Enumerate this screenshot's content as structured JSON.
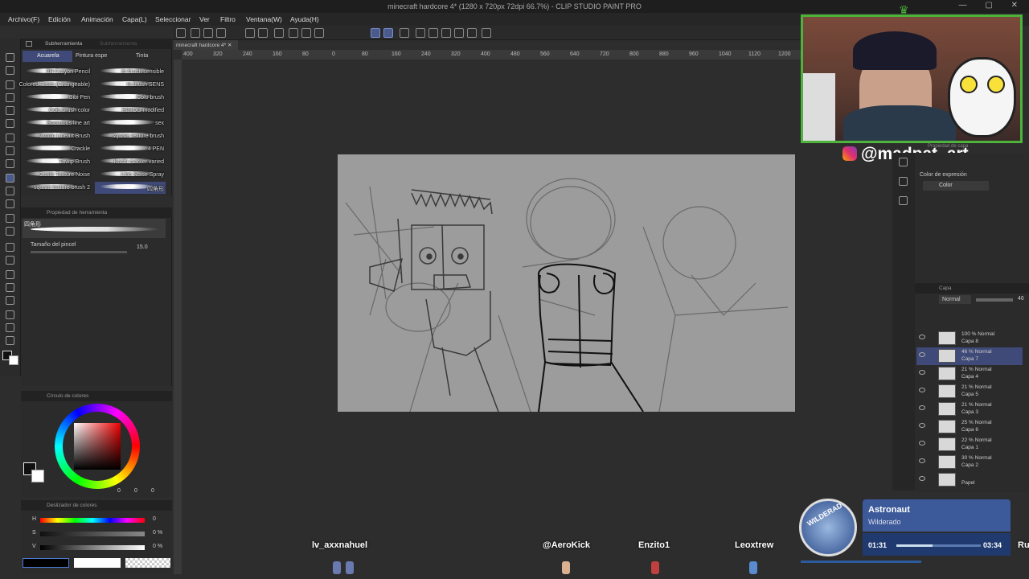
{
  "window": {
    "title": "minecraft hardcore 4* (1280 x 720px 72dpi 66.7%) - CLIP STUDIO PAINT PRO",
    "controls": "— ▢ ✕"
  },
  "menu": [
    "Archivo(F)",
    "Edición",
    "Animación",
    "Capa(L)",
    "Seleccionar",
    "Ver",
    "Filtro",
    "Ventana(W)",
    "Ayuda(H)"
  ],
  "document_tab": "minecraft hardcore 4*",
  "ruler_ticks": [
    "400",
    "320",
    "240",
    "160",
    "80",
    "0",
    "80",
    "160",
    "240",
    "320",
    "400",
    "480",
    "560",
    "640",
    "720",
    "800",
    "880",
    "960",
    "1040",
    "1120",
    "1200"
  ],
  "subtool": {
    "header": "Subherramienta",
    "header2": "Subherramienta",
    "tabs": [
      "Acuarela",
      "Pintura espe",
      "Tinta"
    ],
    "brushes": [
      [
        "3H Crayon Pencil",
        "m brush sensible"
      ],
      [
        "Colored Trees (Changeable)",
        "m brush SENS"
      ],
      [
        "Bibi Pen",
        "Colo brush"
      ],
      [
        "Colo brush color",
        "HIMOG modified"
      ],
      [
        "Succubus line art",
        "sex"
      ],
      [
        "Comic Lineart Brush",
        "square texture brush"
      ],
      [
        "Crackle",
        "4 PEN"
      ],
      [
        "Thwip Brush",
        "Kachi marker varied"
      ],
      [
        "Conte Texture Noise",
        "Line Noise Spray"
      ],
      [
        "square texture brush 2",
        "四角形"
      ]
    ]
  },
  "tool_property": {
    "header": "Propiedad de herramienta",
    "brush_name": "四角形",
    "size_label": "Tamaño del pincel",
    "size_value": "15.0"
  },
  "color_wheel": {
    "header": "Círculo de colores",
    "values": [
      "0",
      "0",
      "0"
    ]
  },
  "color_slider": {
    "header": "Deslizador de colores",
    "labels": [
      "H",
      "S",
      "V"
    ],
    "values": [
      "0",
      "0 %",
      "0 %"
    ]
  },
  "overlay": {
    "handle": "@madpat_art",
    "prop_label": "Propiedad de capa",
    "expression_label": "Color de expresión",
    "expression_value": "Color"
  },
  "layers_panel": {
    "header": "Capa",
    "blend": "Normal",
    "opacity": "46",
    "layers": [
      {
        "pct": "100 % Normal",
        "name": "Capa 8"
      },
      {
        "pct": "46 % Normal",
        "name": "Capa 7",
        "selected": true
      },
      {
        "pct": "21 % Normal",
        "name": "Capa 4"
      },
      {
        "pct": "21 % Normal",
        "name": "Capa 5"
      },
      {
        "pct": "21 % Normal",
        "name": "Capa 3"
      },
      {
        "pct": "25 % Normal",
        "name": "Capa 6"
      },
      {
        "pct": "22 % Normal",
        "name": "Capa 1"
      },
      {
        "pct": "30 % Normal",
        "name": "Capa 2"
      },
      {
        "pct": "",
        "name": "Papel"
      }
    ]
  },
  "music": {
    "title": "Astronaut",
    "artist": "Wilderado",
    "elapsed": "01:31",
    "duration": "03:34",
    "cover_text": "WILDERADO",
    "progress": 0.425
  },
  "viewers": [
    "lv_axxnahuel",
    "@AeroKick",
    "Enzito1",
    "Leoxtrew",
    "Ru"
  ],
  "colors": {
    "accent": "#4db33a",
    "bg": "#2d2d2d",
    "panel": "#2b2b2b",
    "selected_layer": "#3f4a78"
  }
}
